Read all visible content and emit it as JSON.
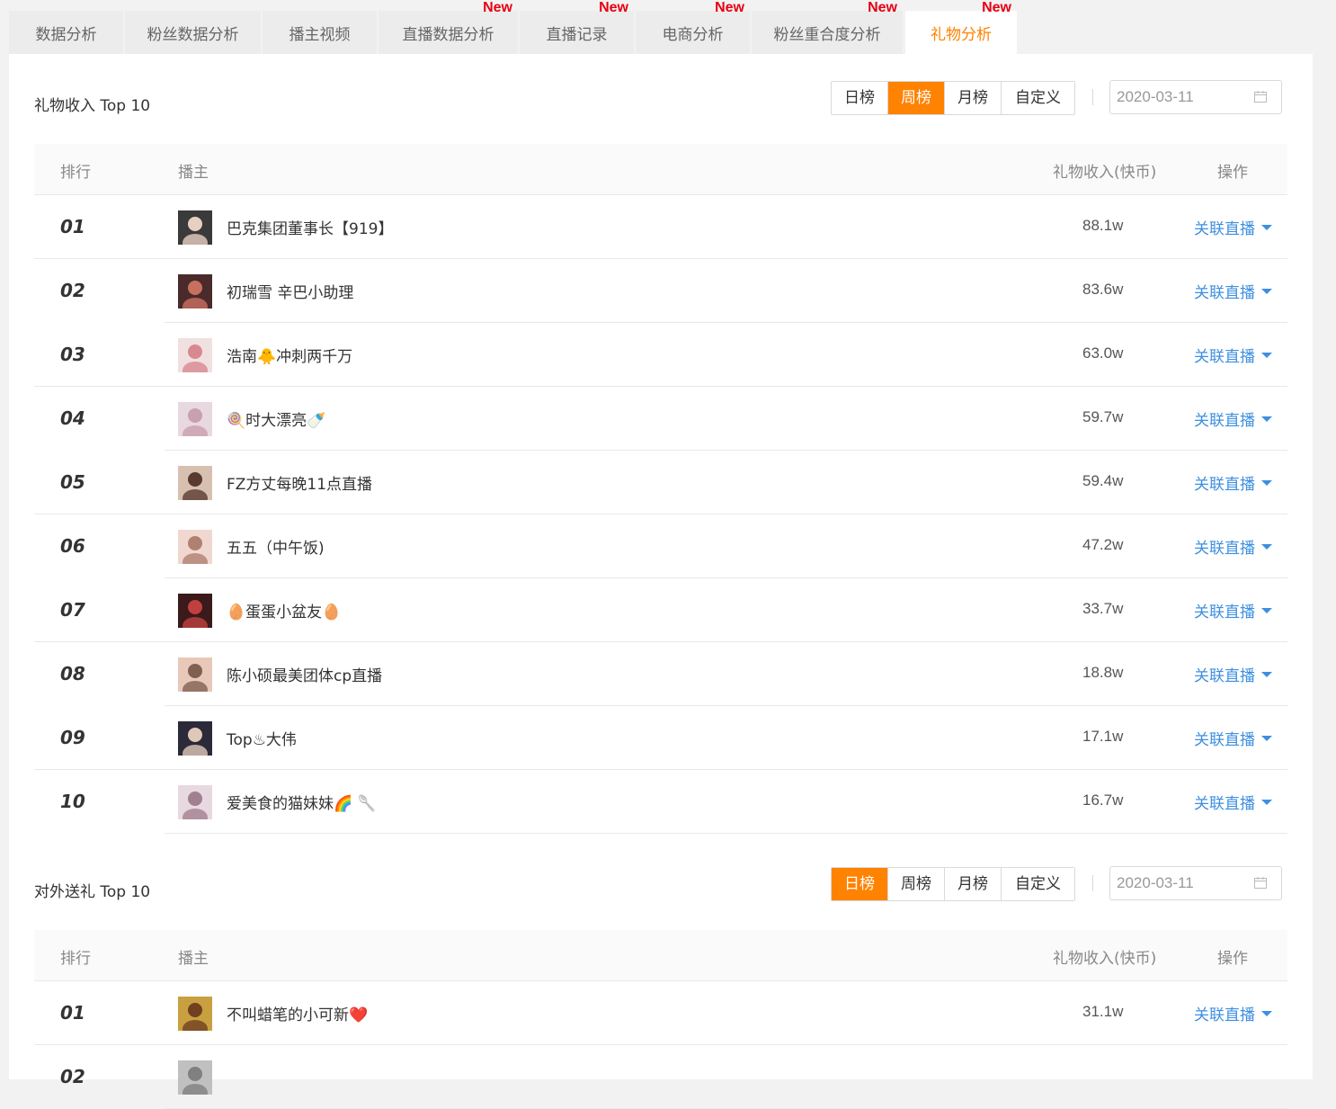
{
  "tabs": [
    {
      "label": "数据分析",
      "new": false
    },
    {
      "label": "粉丝数据分析",
      "new": false
    },
    {
      "label": "播主视频",
      "new": false
    },
    {
      "label": "直播数据分析",
      "new": true
    },
    {
      "label": "直播记录",
      "new": true
    },
    {
      "label": "电商分析",
      "new": true
    },
    {
      "label": "粉丝重合度分析",
      "new": true
    },
    {
      "label": "礼物分析",
      "new": true
    }
  ],
  "new_badge": "New",
  "active_tab": "礼物分析",
  "sections": [
    {
      "title": "礼物收入 Top 10",
      "range_buttons": [
        "日榜",
        "周榜",
        "月榜",
        "自定义"
      ],
      "active_range": "周榜",
      "date_value": "2020-03-11",
      "columns": {
        "rank": "排行",
        "anchor": "播主",
        "income": "礼物收入(快币)",
        "action": "操作"
      },
      "rows": [
        {
          "rank": "01",
          "name": "巴克集团董事长【919】",
          "income": "88.1w",
          "action": "关联直播"
        },
        {
          "rank": "02",
          "name": "初瑞雪 辛巴小助理",
          "income": "83.6w",
          "action": "关联直播"
        },
        {
          "rank": "03",
          "name": "浩南🐥冲刺两千万",
          "income": "63.0w",
          "action": "关联直播"
        },
        {
          "rank": "04",
          "name": "🍭时大漂亮🍼",
          "income": "59.7w",
          "action": "关联直播"
        },
        {
          "rank": "05",
          "name": "FZ方丈每晚11点直播",
          "income": "59.4w",
          "action": "关联直播"
        },
        {
          "rank": "06",
          "name": "五五（中午饭)",
          "income": "47.2w",
          "action": "关联直播"
        },
        {
          "rank": "07",
          "name": "🥚蛋蛋小盆友🥚",
          "income": "33.7w",
          "action": "关联直播"
        },
        {
          "rank": "08",
          "name": "陈小硕最美团体cp直播",
          "income": "18.8w",
          "action": "关联直播"
        },
        {
          "rank": "09",
          "name": "Top♨大伟",
          "income": "17.1w",
          "action": "关联直播"
        },
        {
          "rank": "10",
          "name": "爱美食的猫妹妹🌈 🥄",
          "income": "16.7w",
          "action": "关联直播"
        }
      ]
    },
    {
      "title": "对外送礼 Top 10",
      "range_buttons": [
        "日榜",
        "周榜",
        "月榜",
        "自定义"
      ],
      "active_range": "日榜",
      "date_value": "2020-03-11",
      "columns": {
        "rank": "排行",
        "anchor": "播主",
        "income": "礼物收入(快币)",
        "action": "操作"
      },
      "rows": [
        {
          "rank": "01",
          "name": "不叫蜡笔的小可新❤️",
          "income": "31.1w",
          "action": "关联直播"
        },
        {
          "rank": "02",
          "name": "",
          "income": "",
          "action": ""
        }
      ]
    }
  ],
  "colors": {
    "accent": "#ff8200",
    "link": "#3d8fe0",
    "new_badge": "#e60012"
  }
}
